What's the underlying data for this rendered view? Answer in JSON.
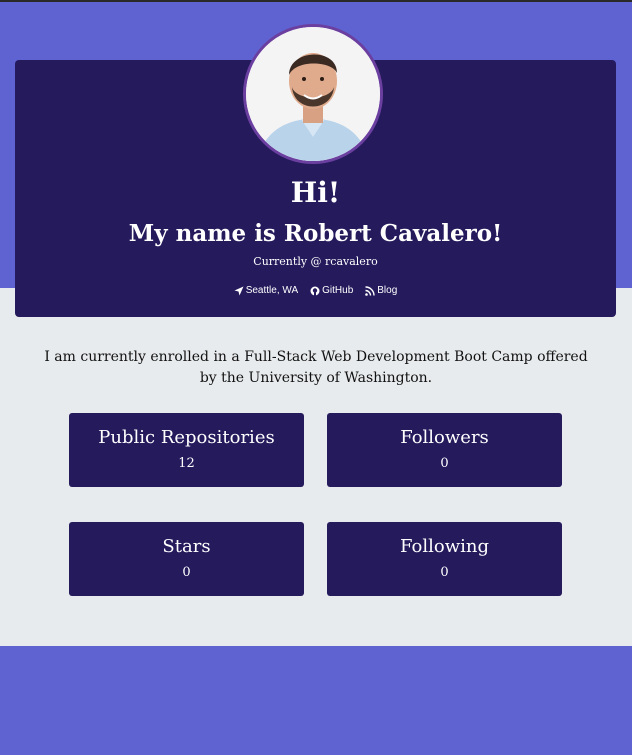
{
  "header": {
    "greeting": "Hi!",
    "name_line": "My name is Robert Cavalero!",
    "current_line": "Currently @ rcavalero",
    "avatar_alt": "profile photo of Robert Cavalero"
  },
  "links": {
    "location": "Seattle, WA",
    "github": "GitHub",
    "blog": "Blog"
  },
  "bio": "I am currently enrolled in a Full-Stack Web Development Boot Camp offered by the University of Washington.",
  "stats": [
    {
      "label": "Public Repositories",
      "value": "12"
    },
    {
      "label": "Followers",
      "value": "0"
    },
    {
      "label": "Stars",
      "value": "0"
    },
    {
      "label": "Following",
      "value": "0"
    }
  ],
  "colors": {
    "page_background": "#5f63d2",
    "content_band": "#e8ebed",
    "card": "#241a5c",
    "avatar_ring": "#6b3fa0"
  },
  "icons": {
    "location": "location-arrow-icon",
    "github": "github-icon",
    "blog": "rss-icon"
  }
}
